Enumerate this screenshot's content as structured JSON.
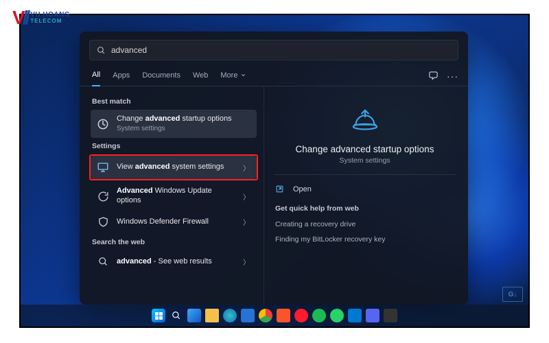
{
  "logo": {
    "brand": "VU HOANG",
    "sub": "TELECOM"
  },
  "search": {
    "query": "advanced"
  },
  "tabs": {
    "items": [
      "All",
      "Apps",
      "Documents",
      "Web"
    ],
    "more": "More",
    "active_index": 0
  },
  "left": {
    "best_match_label": "Best match",
    "best": {
      "line1_pre": "Change ",
      "line1_bold": "advanced",
      "line1_post": "",
      "line2": "startup options",
      "sub": "System settings"
    },
    "settings_label": "Settings",
    "settings": [
      {
        "pre": "View ",
        "bold": "advanced",
        "post": " system",
        "line2": "settings",
        "icon": "monitor"
      },
      {
        "bold": "Advanced",
        "post": " Windows",
        "line2": "Update options",
        "icon": "sync"
      },
      {
        "pre": "Windows Defender",
        "line2": "Firewall",
        "icon": "shield"
      }
    ],
    "web_label": "Search the web",
    "web": {
      "bold": "advanced",
      "post": " - See web",
      "line2": "results"
    }
  },
  "detail": {
    "title": "Change advanced startup options",
    "sub": "System settings",
    "open": "Open",
    "help_label": "Get quick help from web",
    "help_links": [
      "Creating a recovery drive",
      "Finding my BitLocker recovery key"
    ]
  },
  "taskbar": {
    "icons": [
      "start",
      "search",
      "widgets",
      "explorer",
      "edge",
      "store",
      "chrome",
      "brave",
      "opera",
      "spotify",
      "whatsapp",
      "vscode",
      "discord",
      "terminal"
    ]
  }
}
